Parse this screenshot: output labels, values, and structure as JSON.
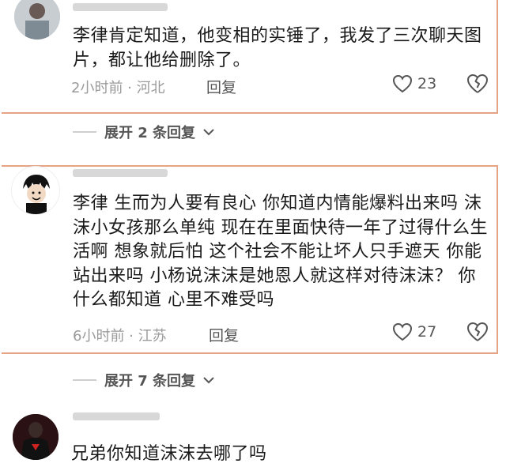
{
  "comments": [
    {
      "text": "李律肯定知道，他变相的实锤了，我发了三次聊天图片，都让他给删除了。",
      "meta": "2小时前 · 河北",
      "reply_label": "回复",
      "likes": "23",
      "expand_label": "展开 2 条回复"
    },
    {
      "text": "李律 生而为人要有良心 你知道内情能爆料出来吗 沫沫小女孩那么单纯 现在在里面快待一年了过得什么生活啊 想象就后怕 这个社会不能让坏人只手遮天 你能站出来吗 小杨说沫沫是她恩人就这样对待沫沫？ 你什么都知道 心里不难受吗",
      "meta": "6小时前 · 江苏",
      "reply_label": "回复",
      "likes": "27",
      "expand_label": "展开 7 条回复"
    },
    {
      "text": "兄弟你知道沫沫去哪了吗"
    }
  ],
  "colors": {
    "highlight_border": "#e6a385",
    "meta_text": "#9a9a9a"
  },
  "icons": [
    "heart-icon",
    "broken-heart-icon",
    "chevron-down-icon"
  ]
}
